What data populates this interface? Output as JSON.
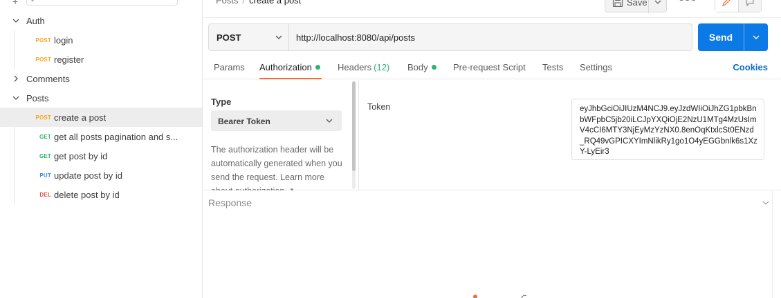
{
  "sidebar": {
    "filter_text": "-",
    "folders": [
      {
        "label": "Auth",
        "expanded": true
      },
      {
        "label": "Comments",
        "expanded": false
      },
      {
        "label": "Posts",
        "expanded": true
      }
    ],
    "auth_items": [
      {
        "method": "POST",
        "label": "login"
      },
      {
        "method": "POST",
        "label": "register"
      }
    ],
    "posts_items": [
      {
        "method": "POST",
        "label": "create a post"
      },
      {
        "method": "GET",
        "label": "get all posts pagination and s..."
      },
      {
        "method": "GET",
        "label": "get post by id"
      },
      {
        "method": "PUT",
        "label": "update post by id"
      },
      {
        "method": "DEL",
        "label": "delete post by id"
      }
    ]
  },
  "header": {
    "breadcrumb_parent": "Posts",
    "breadcrumb_separator": "/",
    "breadcrumb_current": "create a post",
    "save_label": "Save",
    "more_label": "ooo"
  },
  "request": {
    "method": "POST",
    "url": "http://localhost:8080/api/posts",
    "send_label": "Send"
  },
  "tabs": {
    "params": "Params",
    "authorization": "Authorization",
    "headers": "Headers",
    "headers_count": "(12)",
    "body": "Body",
    "prerequest": "Pre-request Script",
    "tests": "Tests",
    "settings": "Settings",
    "cookies": "Cookies"
  },
  "auth": {
    "type_title": "Type",
    "type_value": "Bearer Token",
    "description": "The authorization header will be automatically generated when you send the request. Learn more about authorization ↗",
    "token_label": "Token",
    "token_value": "eyJhbGciOiJIUzM4NCJ9.eyJzdWIiOiJhZG1pbkBnbWFpbC5jb20iLCJpYXQiOjE2NzU1MTg4MzUsImV4cCI6MTY3NjEyMzYzNX0.8enOqKtxlcSt0ENzd_RQ49vGPICXYImNlikRy1go1O4yEGGbnlk6s1XzY-LyEir3"
  },
  "response": {
    "label": "Response"
  },
  "colors": {
    "accent": "#0b7ae6",
    "tab_underline": "#f26b3a",
    "post": "#f5a623",
    "get": "#2fb36f",
    "put": "#3f8ee5",
    "del": "#e54b4b"
  }
}
